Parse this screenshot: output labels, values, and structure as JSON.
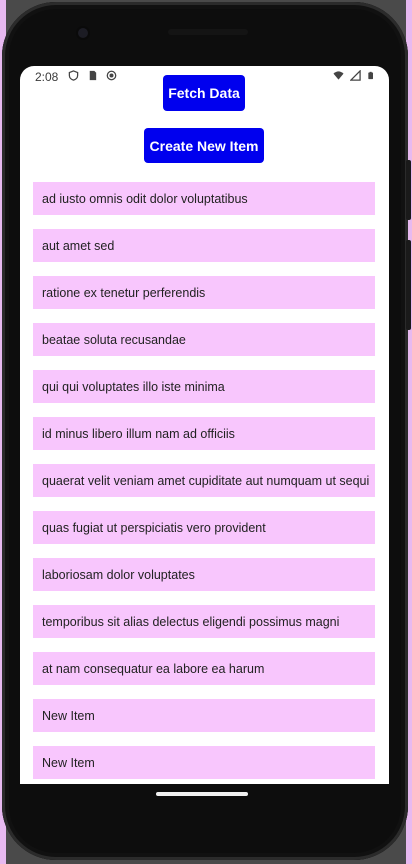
{
  "status_bar": {
    "time": "2:08",
    "left_icons": [
      "shield-icon",
      "sim-card-icon",
      "record-icon"
    ],
    "right_icons": [
      "wifi-icon",
      "signal-icon",
      "battery-icon"
    ]
  },
  "buttons": {
    "fetch_label": "Fetch Data",
    "create_label": "Create New Item",
    "accent_color": "#0000ee"
  },
  "list": {
    "item_background": "#f8c6fd",
    "items": [
      "ad iusto omnis odit dolor voluptatibus",
      "aut amet sed",
      "ratione ex tenetur perferendis",
      "beatae soluta recusandae",
      "qui qui voluptates illo iste minima",
      "id minus libero illum nam ad officiis",
      "quaerat velit veniam amet cupiditate aut numquam ut sequi",
      "quas fugiat ut perspiciatis vero provident",
      "laboriosam dolor voluptates",
      "temporibus sit alias delectus eligendi possimus magni",
      "at nam consequatur ea labore ea harum",
      "New Item",
      "New Item"
    ]
  }
}
